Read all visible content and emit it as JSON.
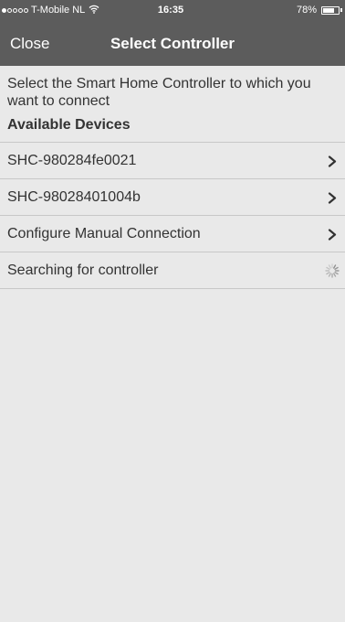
{
  "status_bar": {
    "carrier": "T-Mobile NL",
    "time": "16:35",
    "battery": "78%",
    "battery_level": 0.78,
    "signal_bars_filled": 1,
    "signal_bars_total": 5
  },
  "nav": {
    "close_label": "Close",
    "title": "Select Controller"
  },
  "main": {
    "instruction": "Select the Smart Home Controller to which you want to connect",
    "section_header": "Available Devices",
    "items": [
      {
        "label": "SHC-980284fe0021",
        "icon": "chevron-right-icon"
      },
      {
        "label": "SHC-98028401004b",
        "icon": "chevron-right-icon"
      },
      {
        "label": "Configure Manual Connection",
        "icon": "chevron-right-icon"
      },
      {
        "label": "Searching for controller",
        "icon": "spinner-icon"
      }
    ]
  },
  "colors": {
    "header_bg": "#5c5c5c",
    "page_bg": "#e9e9e9",
    "text": "#333333",
    "divider": "#c8c8c8"
  }
}
